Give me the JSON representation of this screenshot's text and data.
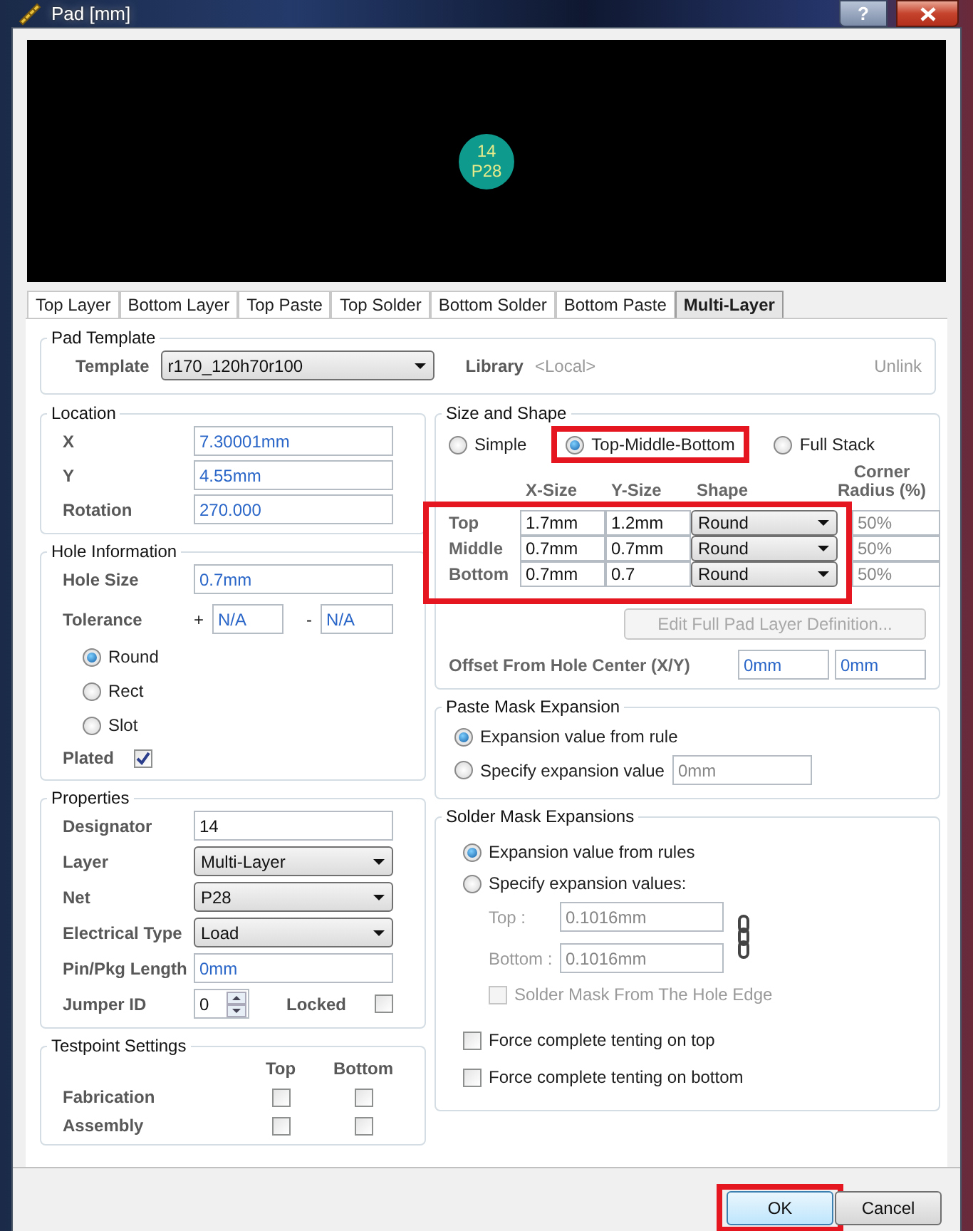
{
  "window": {
    "title": "Pad [mm]",
    "help_button": "?"
  },
  "preview": {
    "designator": "14",
    "net": "P28"
  },
  "tabs": [
    {
      "label": "Top Layer",
      "selected": false
    },
    {
      "label": "Bottom Layer",
      "selected": false
    },
    {
      "label": "Top Paste",
      "selected": false
    },
    {
      "label": "Top Solder",
      "selected": false
    },
    {
      "label": "Bottom Solder",
      "selected": false
    },
    {
      "label": "Bottom Paste",
      "selected": false
    },
    {
      "label": "Multi-Layer",
      "selected": true
    }
  ],
  "pad_template": {
    "title": "Pad Template",
    "template_label": "Template",
    "template_value": "r170_120h70r100",
    "library_label": "Library",
    "library_value": "<Local>",
    "unlink": "Unlink"
  },
  "location": {
    "title": "Location",
    "fields": [
      {
        "label": "X",
        "value": "7.30001mm"
      },
      {
        "label": "Y",
        "value": "4.55mm"
      },
      {
        "label": "Rotation",
        "value": "270.000"
      }
    ]
  },
  "hole_information": {
    "title": "Hole Information",
    "hole_size_label": "Hole Size",
    "hole_size": "0.7mm",
    "tolerance_label": "Tolerance",
    "plus": "+",
    "tolerance_plus": "N/A",
    "minus": "-",
    "tolerance_minus": "N/A",
    "shapes": [
      {
        "label": "Round",
        "selected": true
      },
      {
        "label": "Rect",
        "selected": false
      },
      {
        "label": "Slot",
        "selected": false
      }
    ],
    "plated_label": "Plated",
    "plated": true
  },
  "properties": {
    "title": "Properties",
    "rows": [
      {
        "kind": "text",
        "label": "Designator",
        "value": "14"
      },
      {
        "kind": "dropdown",
        "label": "Layer",
        "value": "Multi-Layer"
      },
      {
        "kind": "dropdown",
        "label": "Net",
        "value": "P28"
      },
      {
        "kind": "dropdown",
        "label": "Electrical Type",
        "value": "Load"
      },
      {
        "kind": "numeric",
        "label": "Pin/Pkg Length",
        "value": "0mm"
      },
      {
        "kind": "spinner",
        "label": "Jumper ID",
        "value": "0"
      }
    ],
    "locked_label": "Locked",
    "locked": false
  },
  "testpoint": {
    "title": "Testpoint Settings",
    "columns": [
      "Top",
      "Bottom"
    ],
    "rows": [
      {
        "label": "Fabrication",
        "top": false,
        "bottom": false
      },
      {
        "label": "Assembly",
        "top": false,
        "bottom": false
      }
    ]
  },
  "size_and_shape": {
    "title": "Size and Shape",
    "modes": [
      {
        "label": "Simple",
        "selected": false,
        "highlighted": false
      },
      {
        "label": "Top-Middle-Bottom",
        "selected": true,
        "highlighted": true
      },
      {
        "label": "Full Stack",
        "selected": false,
        "highlighted": false
      }
    ],
    "columns": [
      "X-Size",
      "Y-Size",
      "Shape",
      "Corner Radius (%)"
    ],
    "table_highlighted": true,
    "rows": [
      {
        "label": "Top",
        "x_size": "1.7mm",
        "y_size": "1.2mm",
        "shape": "Round",
        "corner_radius": "50%"
      },
      {
        "label": "Middle",
        "x_size": "0.7mm",
        "y_size": "0.7mm",
        "shape": "Round",
        "corner_radius": "50%"
      },
      {
        "label": "Bottom",
        "x_size": "0.7mm",
        "y_size": "0.7",
        "shape": "Round",
        "corner_radius": "50%"
      }
    ],
    "edit_button": "Edit Full Pad Layer Definition...",
    "offset_label": "Offset From Hole Center (X/Y)",
    "offset_x": "0mm",
    "offset_y": "0mm"
  },
  "paste_mask": {
    "title": "Paste Mask Expansion",
    "options": [
      {
        "label": "Expansion value from rule",
        "selected": true
      },
      {
        "label": "Specify expansion value",
        "selected": false
      }
    ],
    "value": "0mm"
  },
  "solder_mask": {
    "title": "Solder Mask Expansions",
    "options": [
      {
        "label": "Expansion value from rules",
        "selected": true
      },
      {
        "label": "Specify expansion values:",
        "selected": false
      }
    ],
    "values_disabled": true,
    "top_label": "Top :",
    "top_value": "0.1016mm",
    "bottom_label": "Bottom :",
    "bottom_value": "0.1016mm",
    "hole_edge": {
      "label": "Solder Mask From The Hole Edge",
      "checked": false,
      "disabled": true
    },
    "tenting": [
      {
        "label": "Force complete tenting on top",
        "checked": false
      },
      {
        "label": "Force complete tenting on bottom",
        "checked": false
      }
    ]
  },
  "buttons": [
    {
      "label": "OK",
      "default": true,
      "highlighted": true
    },
    {
      "label": "Cancel",
      "default": false,
      "highlighted": false
    }
  ]
}
